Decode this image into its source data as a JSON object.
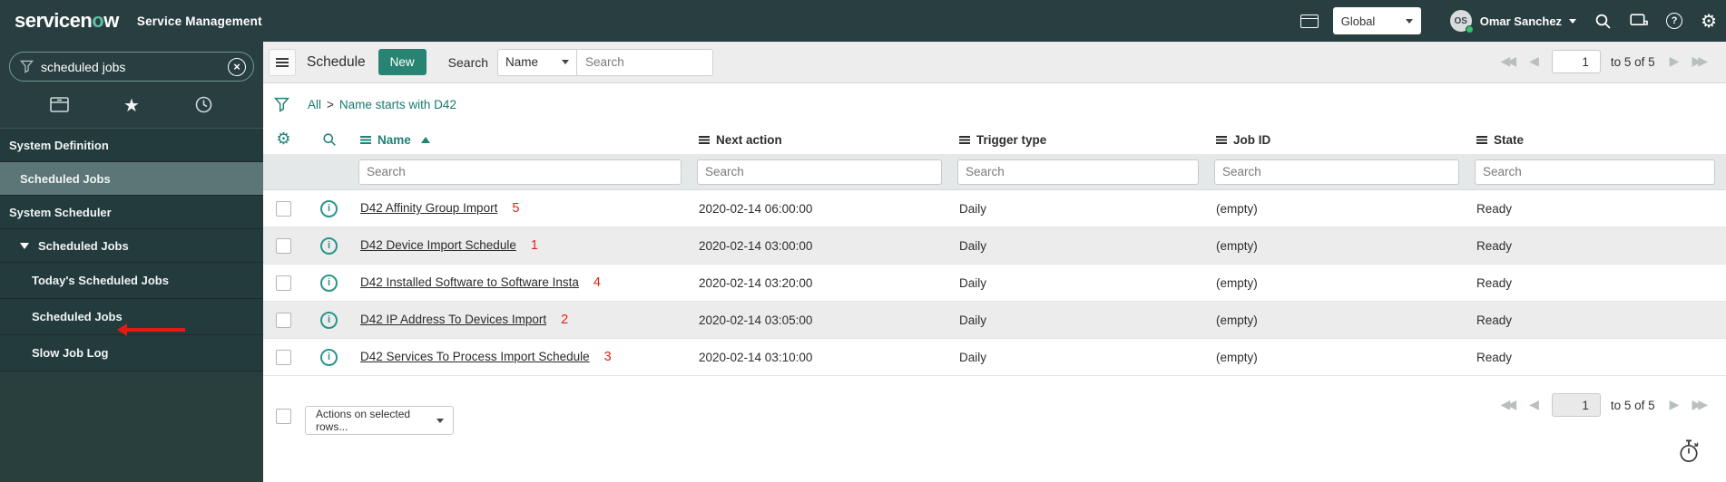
{
  "banner": {
    "logo_prefix": "servicen",
    "logo_o": "o",
    "logo_suffix": "w",
    "product": "Service Management",
    "scope_value": "Global",
    "user_initials": "OS",
    "user_name": "Omar Sanchez"
  },
  "sidebar": {
    "search_value": "scheduled jobs",
    "nav": [
      {
        "label": "System Definition"
      },
      {
        "label": "Scheduled Jobs"
      },
      {
        "label": "System Scheduler"
      },
      {
        "label": "Scheduled Jobs"
      },
      {
        "label": "Today's Scheduled Jobs"
      },
      {
        "label": "Scheduled Jobs"
      },
      {
        "label": "Slow Job Log"
      }
    ]
  },
  "toolbar": {
    "title": "Schedule",
    "new_button": "New",
    "search_label": "Search",
    "search_field_selected": "Name",
    "search_placeholder": "Search"
  },
  "pagination": {
    "page": "1",
    "range_label": "to 5 of 5"
  },
  "breadcrumb": {
    "root": "All",
    "separator": ">",
    "condition": "Name starts with D42"
  },
  "list": {
    "columns": [
      "Name",
      "Next action",
      "Trigger type",
      "Job ID",
      "State"
    ],
    "sort_column": "Name",
    "filter_placeholder": "Search",
    "rows": [
      {
        "name": "D42 Affinity Group Import",
        "annotation": "5",
        "next_action": "2020-02-14 06:00:00",
        "trigger_type": "Daily",
        "job_id": "(empty)",
        "state": "Ready"
      },
      {
        "name": "D42 Device Import Schedule",
        "annotation": "1",
        "next_action": "2020-02-14 03:00:00",
        "trigger_type": "Daily",
        "job_id": "(empty)",
        "state": "Ready"
      },
      {
        "name": "D42 Installed Software to Software Insta",
        "annotation": "4",
        "next_action": "2020-02-14 03:20:00",
        "trigger_type": "Daily",
        "job_id": "(empty)",
        "state": "Ready"
      },
      {
        "name": "D42 IP Address To Devices Import",
        "annotation": "2",
        "next_action": "2020-02-14 03:05:00",
        "trigger_type": "Daily",
        "job_id": "(empty)",
        "state": "Ready"
      },
      {
        "name": "D42 Services To Process Import Schedule",
        "annotation": "3",
        "next_action": "2020-02-14 03:10:00",
        "trigger_type": "Daily",
        "job_id": "(empty)",
        "state": "Ready"
      }
    ]
  },
  "footer": {
    "actions_label": "Actions on selected rows..."
  },
  "colors": {
    "header_bg": "#293e40",
    "accent_green": "#278372",
    "sorted_column_teal": "#1f8476",
    "breadcrumb_link": "#157c6e",
    "annotation_red": "#e0231a",
    "row_stripe": "#ececec",
    "selected_nav": "#5c7577"
  }
}
